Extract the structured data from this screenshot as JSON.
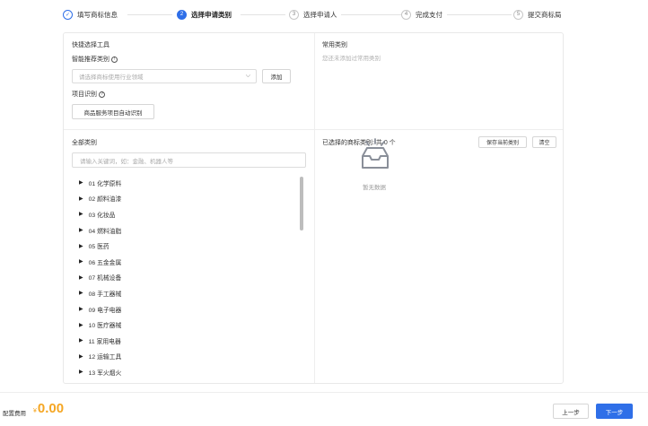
{
  "steps": [
    {
      "num": "✓",
      "label": "填写商标信息",
      "state": "done"
    },
    {
      "num": "2",
      "label": "选择申请类别",
      "state": "active"
    },
    {
      "num": "3",
      "label": "选择申请人",
      "state": "pending"
    },
    {
      "num": "4",
      "label": "完成支付",
      "state": "pending"
    },
    {
      "num": "5",
      "label": "提交商标局",
      "state": "pending"
    }
  ],
  "quick": {
    "title": "快捷选择工具",
    "smart_label": "智能推荐类别",
    "select_placeholder": "请选择商标使用行业领域",
    "add_button": "添加",
    "project_label": "项目识别",
    "auto_button": "商品服务项目自动识别"
  },
  "common": {
    "title": "常用类别",
    "empty": "您还未添加过常用类别"
  },
  "all": {
    "title": "全部类别",
    "search_placeholder": "请输入关键词，如：金融、机器人等",
    "categories": [
      "01 化学原料",
      "02 颜料油漆",
      "03 化妆品",
      "04 燃料油脂",
      "05 医药",
      "06 五金金属",
      "07 机械设备",
      "08 手工器械",
      "09 电子电器",
      "10 医疗器械",
      "11 家用电器",
      "12 运输工具",
      "13 军火烟火"
    ]
  },
  "selected": {
    "title": "已选择的商标类别: 共 0 个",
    "save_button": "保存当前类别",
    "clear_button": "清空",
    "empty": "暂无数据"
  },
  "footer": {
    "fee_label": "配置费用",
    "currency": "¥",
    "fee": "0.00",
    "prev": "上一步",
    "next": "下一步"
  }
}
